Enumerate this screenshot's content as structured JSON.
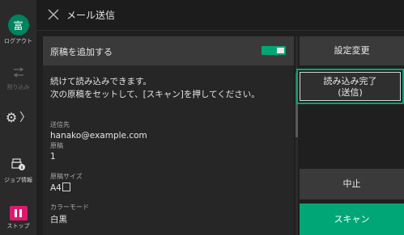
{
  "sidebar": {
    "avatar_char": "富",
    "logout_label": "ログアウト",
    "interrupt_label": "割り込み",
    "job_label": "ジョブ情報",
    "stop_label": "ストップ"
  },
  "header": {
    "title": "メール送信"
  },
  "panel": {
    "add_original_label": "原稿を追加する",
    "message_line1": "続けて読み込みできます。",
    "message_line2": "次の原稿をセットして、[スキャン]を押してください。",
    "fields": [
      {
        "label": "送信先",
        "value": "hanako@example.com"
      },
      {
        "label": "原稿",
        "value": "1"
      },
      {
        "label": "原稿サイズ",
        "value": "A4"
      },
      {
        "label": "カラーモード",
        "value": "白黒"
      }
    ]
  },
  "actions": {
    "settings_change": "設定変更",
    "finish_line1": "読み込み完了",
    "finish_line2": "(送信)",
    "cancel": "中止",
    "scan": "スキャン"
  },
  "colors": {
    "accent": "#00a676",
    "stop": "#e0186c",
    "avatar": "#00835f"
  }
}
